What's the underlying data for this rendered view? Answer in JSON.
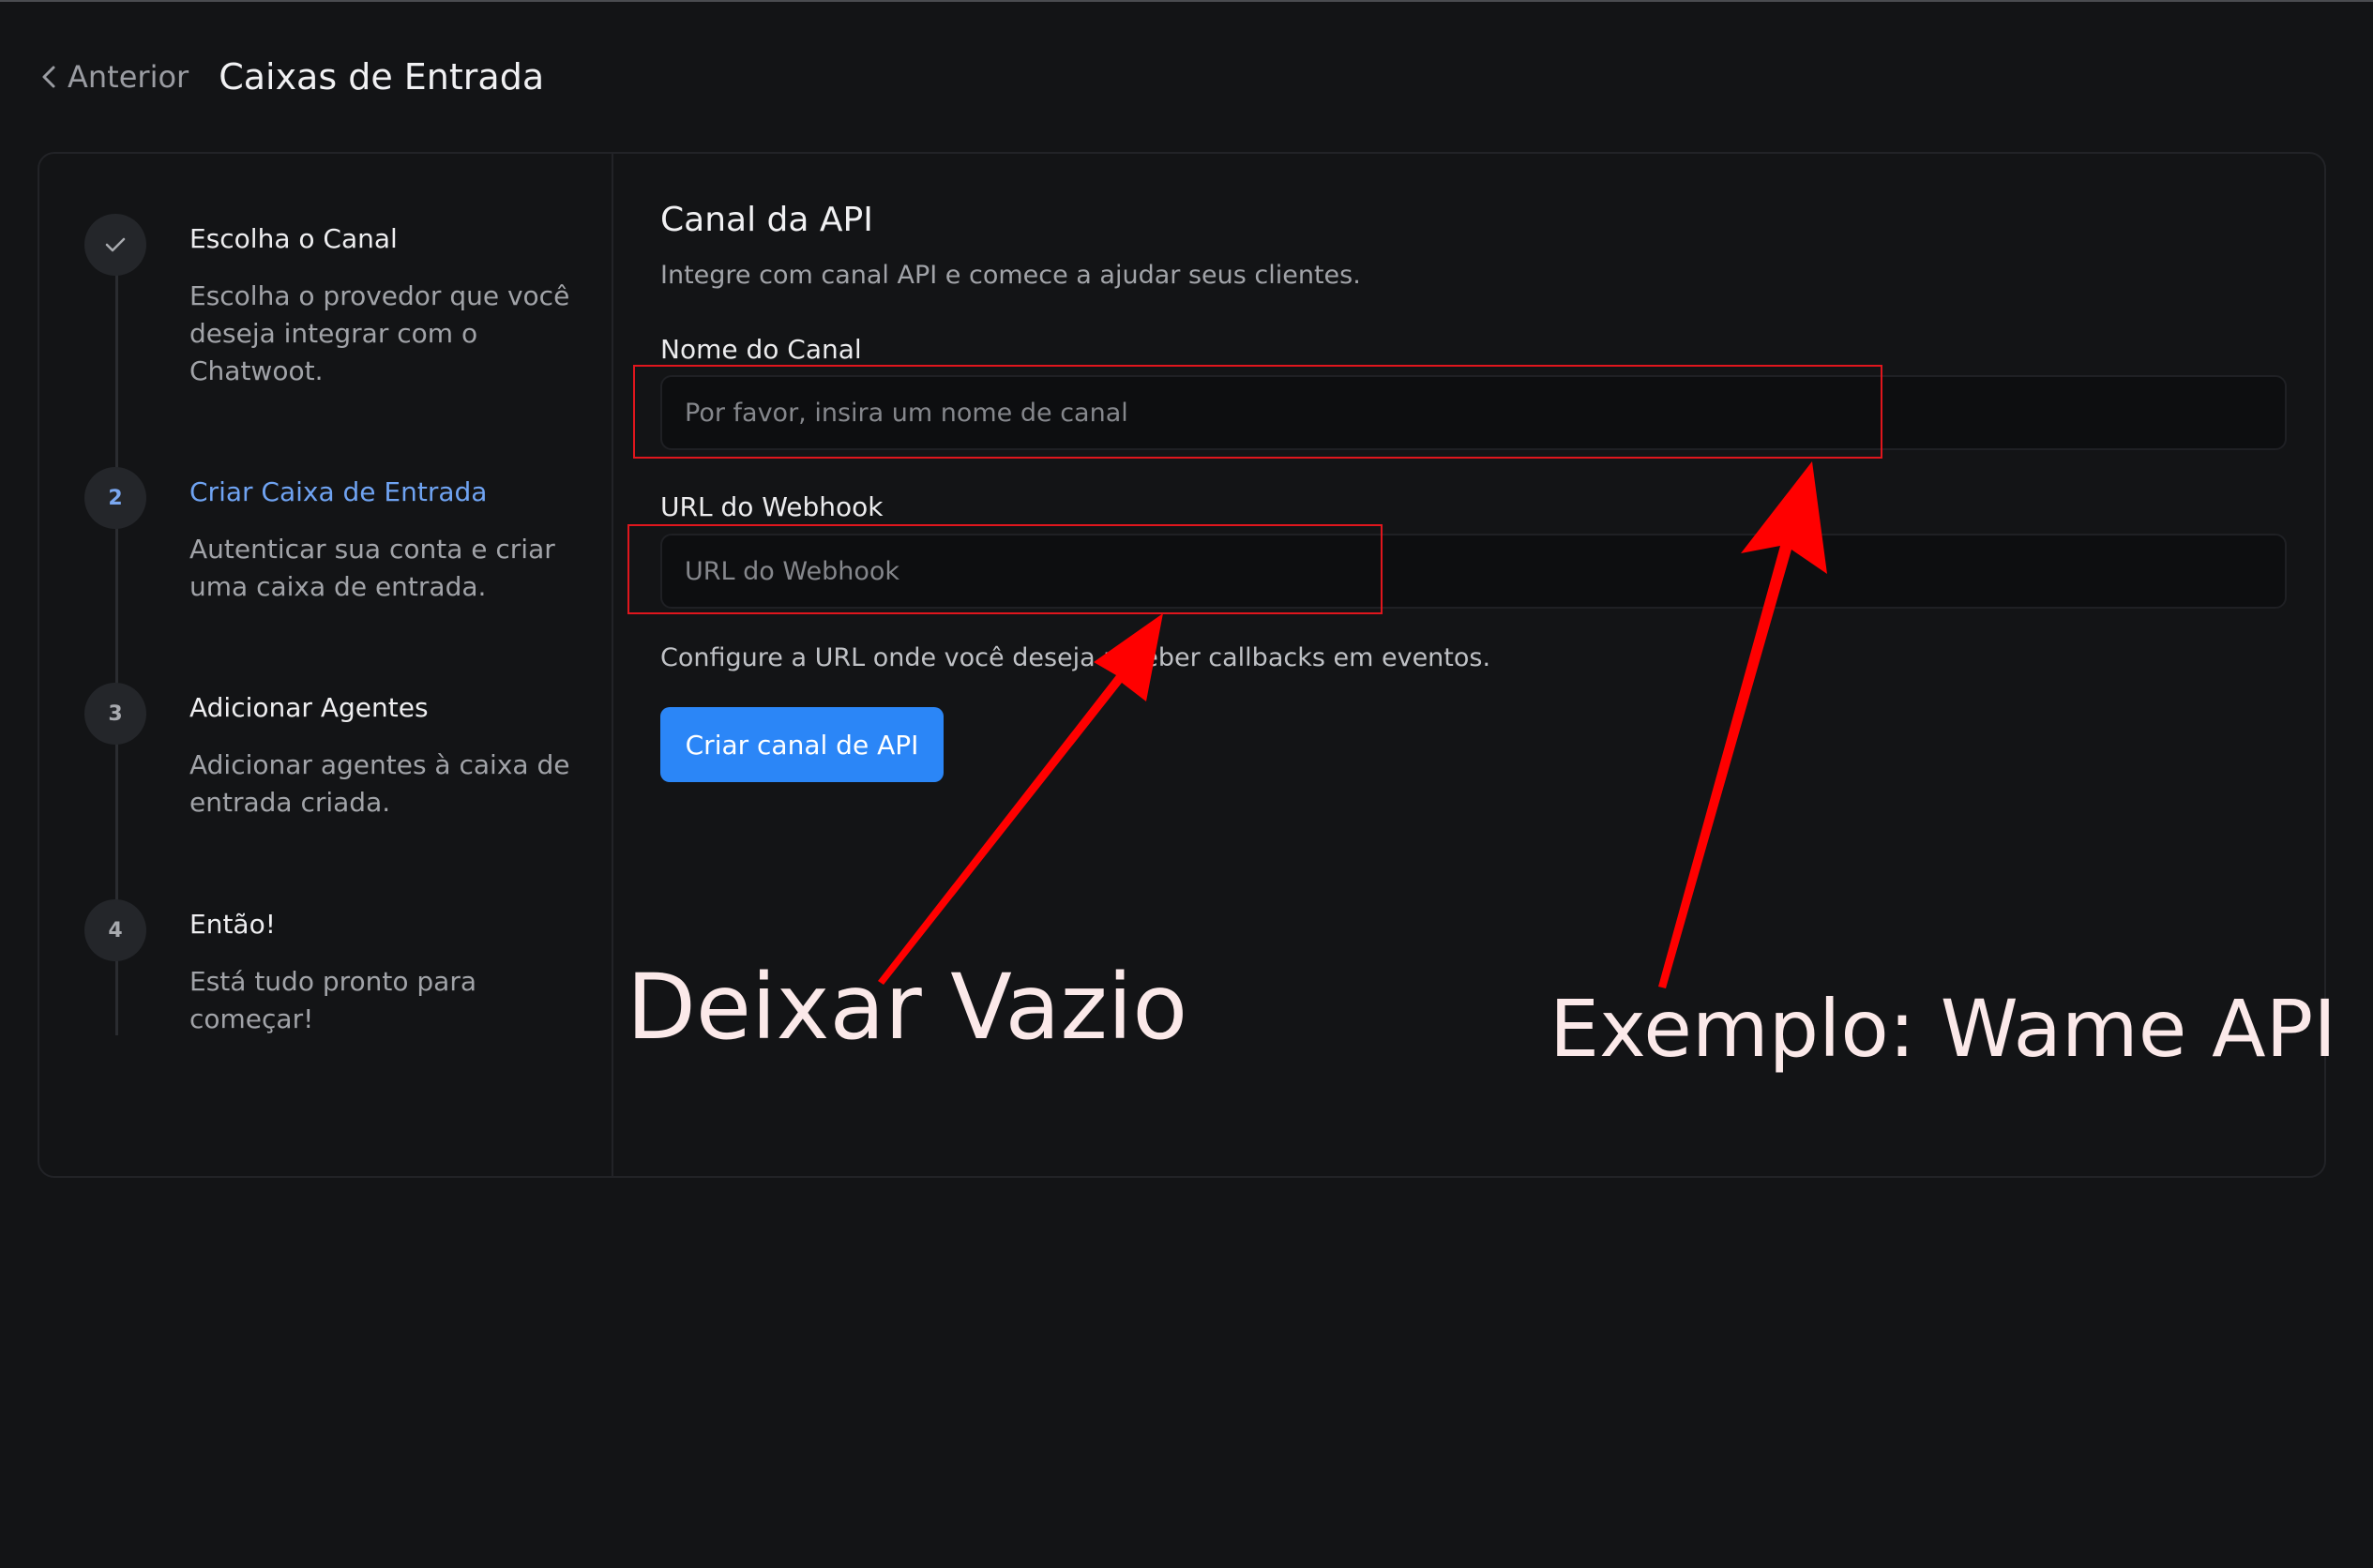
{
  "header": {
    "back_label": "Anterior",
    "title": "Caixas de Entrada"
  },
  "steps": [
    {
      "marker": "",
      "icon": "check-icon",
      "title": "Escolha o Canal",
      "description": "Escolha o provedor que você deseja integrar com o Chatwoot.",
      "state": "done"
    },
    {
      "marker": "2",
      "title": "Criar Caixa de Entrada",
      "description": "Autenticar sua conta e criar uma caixa de entrada.",
      "state": "active"
    },
    {
      "marker": "3",
      "title": "Adicionar Agentes",
      "description": "Adicionar agentes à caixa de entrada criada.",
      "state": "pending"
    },
    {
      "marker": "4",
      "title": "Então!",
      "description": "Está tudo pronto para começar!",
      "state": "pending"
    }
  ],
  "form": {
    "title": "Canal da API",
    "description": "Integre com canal API e comece a ajudar seus clientes.",
    "channel_name": {
      "label": "Nome do Canal",
      "value": "",
      "placeholder": "Por favor, insira um nome de canal"
    },
    "webhook_url": {
      "label": "URL do Webhook",
      "value": "",
      "placeholder": "URL do Webhook"
    },
    "help_text": "Configure a URL onde você deseja receber callbacks em eventos.",
    "submit_label": "Criar canal de API"
  },
  "annotations": {
    "webhook_note": "Deixar Vazio",
    "channel_note": "Exemplo: Wame API",
    "highlight_color": "#e0161d",
    "arrow_color": "#ff0000",
    "text_color": "#fbe9e9"
  },
  "colors": {
    "background": "#131416",
    "accent": "#2b86f7",
    "active_step": "#6fa3f2"
  }
}
